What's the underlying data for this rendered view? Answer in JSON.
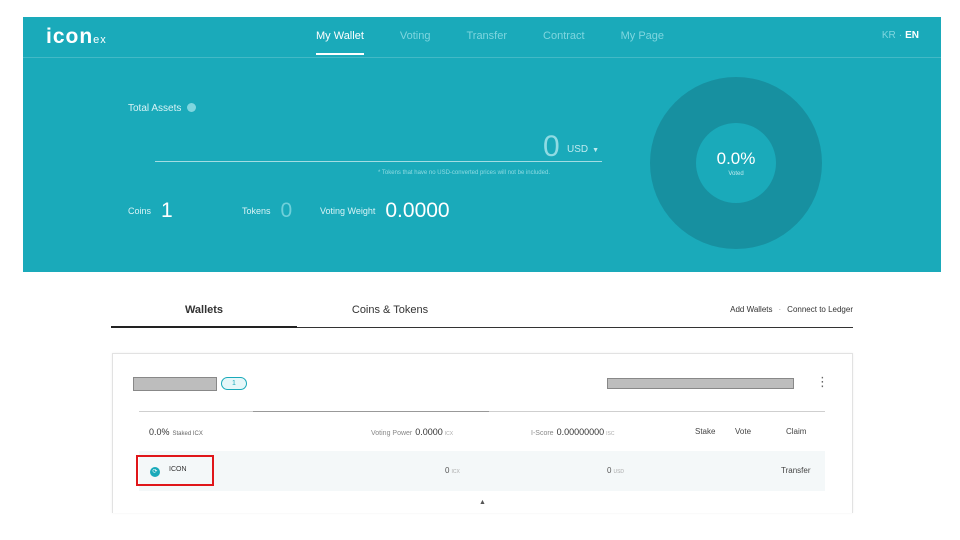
{
  "header": {
    "logo": "icon",
    "logo_suffix": "ex",
    "nav": [
      "My Wallet",
      "Voting",
      "Transfer",
      "Contract",
      "My Page"
    ],
    "lang": {
      "kr": "KR",
      "en": "EN",
      "sep": "·"
    }
  },
  "summary": {
    "total_label": "Total Assets",
    "total_value": "0",
    "currency": "USD",
    "note": "* Tokens that have no USD-converted prices will not be included.",
    "coins_label": "Coins",
    "coins_value": "1",
    "tokens_label": "Tokens",
    "tokens_value": "0",
    "voting_weight_label": "Voting Weight",
    "voting_weight_value": "0.0000",
    "donut_value": "0.0%",
    "donut_label": "Voted",
    "voted_fraction": 0
  },
  "tabs": {
    "wallets": "Wallets",
    "coins_tokens": "Coins & Tokens",
    "add_wallets": "Add Wallets",
    "link_sep": "·",
    "connect_ledger": "Connect to Ledger"
  },
  "wallet": {
    "count": "1",
    "kebab": "⋮",
    "staked_pct": "0.0%",
    "staked_label": "Staked ICX",
    "voting_power_label": "Voting Power",
    "voting_power_value": "0.0000",
    "voting_power_unit": "ICX",
    "iscore_label": "I-Score",
    "iscore_value": "0.00000000",
    "iscore_unit": "ISC",
    "stake": "Stake",
    "vote": "Vote",
    "claim": "Claim",
    "coin_name": "ICON",
    "coin_balance": "0",
    "coin_unit": "ICX",
    "coin_usd": "0",
    "usd_unit": "USD",
    "transfer": "Transfer",
    "collapse": "▲"
  },
  "colors": {
    "brand": "#1aaaba",
    "donut": "#1790a0",
    "highlight": "#e0161a"
  }
}
